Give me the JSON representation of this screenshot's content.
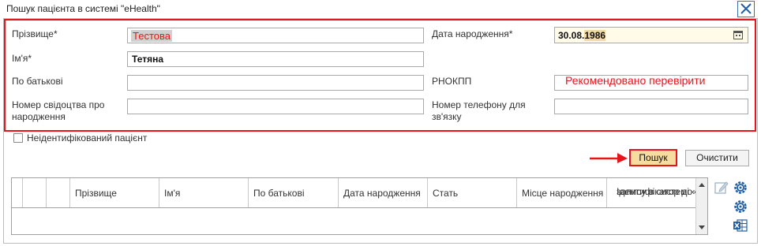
{
  "window": {
    "title": "Пошук пацієнта в системі \"eHealth\""
  },
  "form": {
    "surname_label": "Прізвище*",
    "surname_value": "Тестова",
    "name_label": "Ім'я*",
    "name_value": "Тетяна",
    "patronymic_label": "По батькові",
    "patronymic_value": "",
    "birth_cert_label_line1": "Номер свідоцтва про",
    "birth_cert_label_line2": "народження",
    "birth_cert_value": "",
    "birthdate_label": "Дата народження*",
    "birthdate_day_month": "30.08.",
    "birthdate_year": "1986",
    "rnokpp_label": "РНОКПП",
    "rnokpp_annotation": "Рекомендовано перевірити",
    "phone_label_line1": "Номер телефону для",
    "phone_label_line2": "зв'язку",
    "phone_value": ""
  },
  "unidentified_label": "Неідентифікований пацієнт",
  "buttons": {
    "search": "Пошук",
    "clear": "Очистити"
  },
  "table": {
    "columns": [
      "Прізвище",
      "Ім'я",
      "По батькові",
      "Дата народження",
      "Стать",
      "Місце народження"
    ],
    "last_column_line1": "Ідентифікатор до п",
    "last_column_line2": "запису в системі «е"
  },
  "icons": [
    "close-icon",
    "calendar-icon",
    "arrow-icon",
    "edit-icon",
    "settings-icon",
    "excel-export-icon"
  ],
  "colors": {
    "highlight_red": "#e8141b",
    "search_button_bg": "#f7dca0",
    "date_field_bg": "#fffbe8"
  }
}
